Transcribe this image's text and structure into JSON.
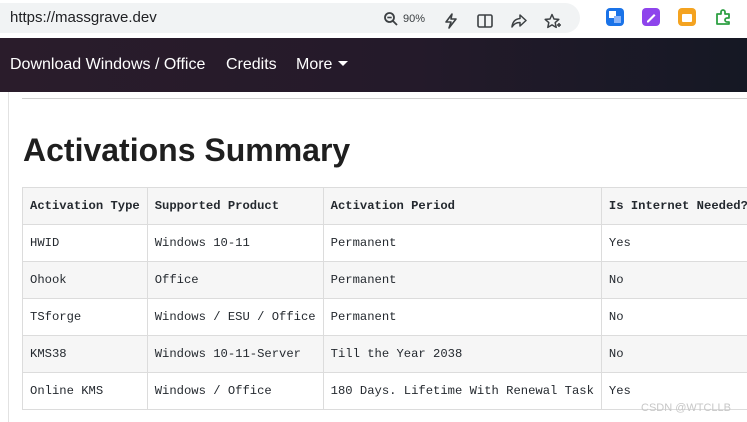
{
  "browser": {
    "url": "https://massgrave.dev",
    "zoom": "90%"
  },
  "nav": {
    "items": [
      "Download Windows / Office",
      "Credits",
      "More"
    ]
  },
  "page": {
    "title": "Activations Summary",
    "table": {
      "headers": [
        "Activation Type",
        "Supported Product",
        "Activation Period",
        "Is Internet Needed?"
      ],
      "rows": [
        [
          "HWID",
          "Windows 10-11",
          "Permanent",
          "Yes"
        ],
        [
          "Ohook",
          "Office",
          "Permanent",
          "No"
        ],
        [
          "TSforge",
          "Windows / ESU / Office",
          "Permanent",
          "No"
        ],
        [
          "KMS38",
          "Windows 10-11-Server",
          "Till the Year 2038",
          "No"
        ],
        [
          "Online KMS",
          "Windows / Office",
          "180 Days. Lifetime With Renewal Task",
          "Yes"
        ]
      ]
    }
  },
  "watermark": "CSDN @WTCLLB",
  "colors": {
    "nav_bg": "#241a2a",
    "header_bg": "#f6f6f6"
  }
}
